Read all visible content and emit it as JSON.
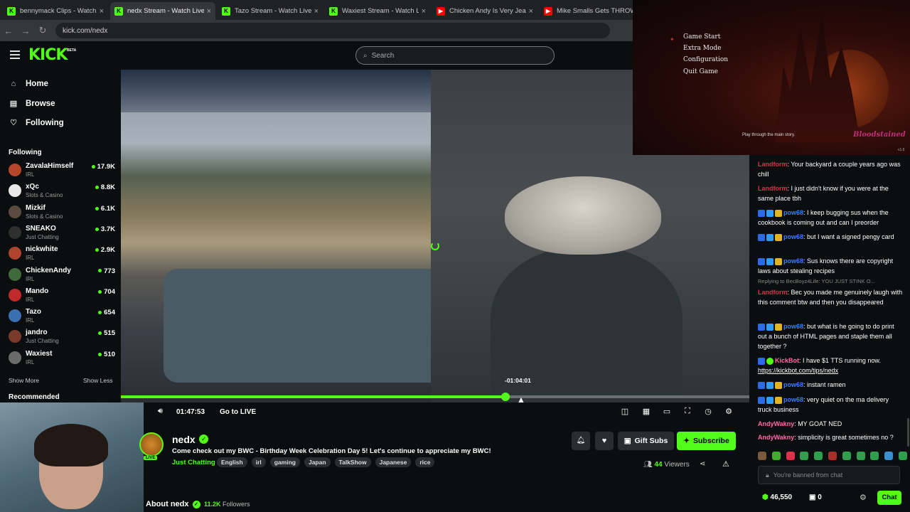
{
  "browser": {
    "tabs": [
      {
        "title": "bennymack Clips - Watch Liv",
        "favicon": "kick",
        "active": false
      },
      {
        "title": "nedx Stream - Watch Live",
        "favicon": "kick",
        "active": true
      },
      {
        "title": "Tazo Stream - Watch Live on",
        "favicon": "kick",
        "active": false
      },
      {
        "title": "Waxiest Stream - Watch Live",
        "favicon": "kick",
        "active": false
      },
      {
        "title": "Chicken Andy Is Very Jealous",
        "favicon": "youtube",
        "active": false
      },
      {
        "title": "Mike Smalls Gets THROWN",
        "favicon": "youtube",
        "active": false
      }
    ],
    "url": "kick.com/nedx"
  },
  "header": {
    "logo": "KICK",
    "beta": "BETA",
    "search_placeholder": "Search"
  },
  "sidebar": {
    "nav": [
      {
        "label": "Home",
        "icon": "home-icon"
      },
      {
        "label": "Browse",
        "icon": "browse-icon"
      },
      {
        "label": "Following",
        "icon": "heart-icon"
      }
    ],
    "following_heading": "Following",
    "channels": [
      {
        "name": "ZavalaHimself",
        "category": "IRL",
        "viewers": "17.9K",
        "color": "#b5462a"
      },
      {
        "name": "xQc",
        "category": "Slots & Casino",
        "viewers": "8.8K",
        "color": "#e8e8e8"
      },
      {
        "name": "Mizkif",
        "category": "Slots & Casino",
        "viewers": "6.1K",
        "color": "#5a4a3f"
      },
      {
        "name": "SNEAKO",
        "category": "Just Chatting",
        "viewers": "3.7K",
        "color": "#2f2f2f"
      },
      {
        "name": "nickwhite",
        "category": "IRL",
        "viewers": "2.9K",
        "color": "#b0442d"
      },
      {
        "name": "ChickenAndy",
        "category": "IRL",
        "viewers": "773",
        "color": "#3f6b3a"
      },
      {
        "name": "Mando",
        "category": "IRL",
        "viewers": "704",
        "color": "#c02a2a"
      },
      {
        "name": "Tazo",
        "category": "IRL",
        "viewers": "654",
        "color": "#3a6fb0"
      },
      {
        "name": "jandro",
        "category": "Just Chatting",
        "viewers": "515",
        "color": "#7a3a2a"
      },
      {
        "name": "Waxiest",
        "category": "IRL",
        "viewers": "510",
        "color": "#6a6a6a"
      }
    ],
    "show_more": "Show More",
    "show_less": "Show Less",
    "recommended_heading": "Recommended"
  },
  "player": {
    "seek_tooltip": "-01:04:01",
    "progress_fraction": 0.612,
    "time": "01:47:53",
    "go_live": "Go to LIVE"
  },
  "stream": {
    "streamer": "nedx",
    "live_badge": "LIVE",
    "title": "Come check out my BWC - Birthday Week Celebration Day 5! Let's continue to appreciate my BWC!",
    "category": "Just Chatting",
    "tags": [
      "English",
      "irl",
      "gaming",
      "Japan",
      "TalkShow",
      "Japanese",
      "rice"
    ],
    "gift_subs": "Gift Subs",
    "subscribe": "Subscribe",
    "viewer_count": "44",
    "viewers_label": "Viewers",
    "about": "About nedx",
    "followers_count": "11.2K",
    "followers_label": "Followers"
  },
  "game_overlay": {
    "menu": [
      "Game Start",
      "Extra Mode",
      "Configuration",
      "Quit Game"
    ],
    "hint": "Play through the main story.",
    "logo": "Bloodstained",
    "version": "v1.6"
  },
  "chat": {
    "messages": [
      {
        "user": "Landform",
        "color": "red",
        "badges": [],
        "text": ": Your backyard a couple years ago was chill"
      },
      {
        "user": "Landform",
        "color": "red",
        "badges": [],
        "text": ": I just didn't know if you were at the same place tbh"
      },
      {
        "user": "pow68",
        "color": "blue",
        "badges": [
          "b1",
          "b2",
          "b3"
        ],
        "text": ": I keep bugging sus when the cookbook is coming out and can I preorder"
      },
      {
        "user": "pow68",
        "color": "blue",
        "badges": [
          "b1",
          "b2",
          "b3"
        ],
        "text": ": but I want a signed pengy card"
      },
      {
        "user": "pow68",
        "color": "blue",
        "badges": [
          "b1",
          "b2",
          "b3"
        ],
        "text": ": Sus knows there are copyright laws about stealing recipes"
      },
      {
        "reply": "Replying to BecBoyz4Life: YOU JUST STINK O...",
        "user": "Landform",
        "color": "red",
        "badges": [],
        "text": ": Bec you made me genuinely laugh with this comment btw and then you disappeared"
      },
      {
        "user": "pow68",
        "color": "blue",
        "badges": [
          "b1",
          "b2",
          "b3"
        ],
        "text": ": but what is he going to do print out a bunch of HTML pages and staple them all together ?"
      },
      {
        "user": "KickBot",
        "color": "pink",
        "badges": [
          "b1",
          "b4"
        ],
        "text": ": I have $1 TTS running now.",
        "link": "https://kickbot.com/tips/nedx"
      },
      {
        "user": "pow68",
        "color": "blue",
        "badges": [
          "b1",
          "b2",
          "b3"
        ],
        "text": ": instant ramen"
      },
      {
        "user": "pow68",
        "color": "blue",
        "badges": [
          "b1",
          "b2",
          "b3"
        ],
        "text": ": very quiet on the ma delivery truck business"
      },
      {
        "user": "AndyWakny",
        "color": "pink",
        "badges": [],
        "text": ": MY GOAT NED"
      },
      {
        "user": "AndyWakny",
        "color": "pink",
        "badges": [],
        "text": ": simplicity is great sometimes no ?"
      }
    ],
    "input_placeholder": "You're banned from chat",
    "points": "46,550",
    "balance": "0",
    "chat_button": "Chat"
  },
  "colors": {
    "accent": "#53fc18",
    "background": "#0b0e0f"
  }
}
